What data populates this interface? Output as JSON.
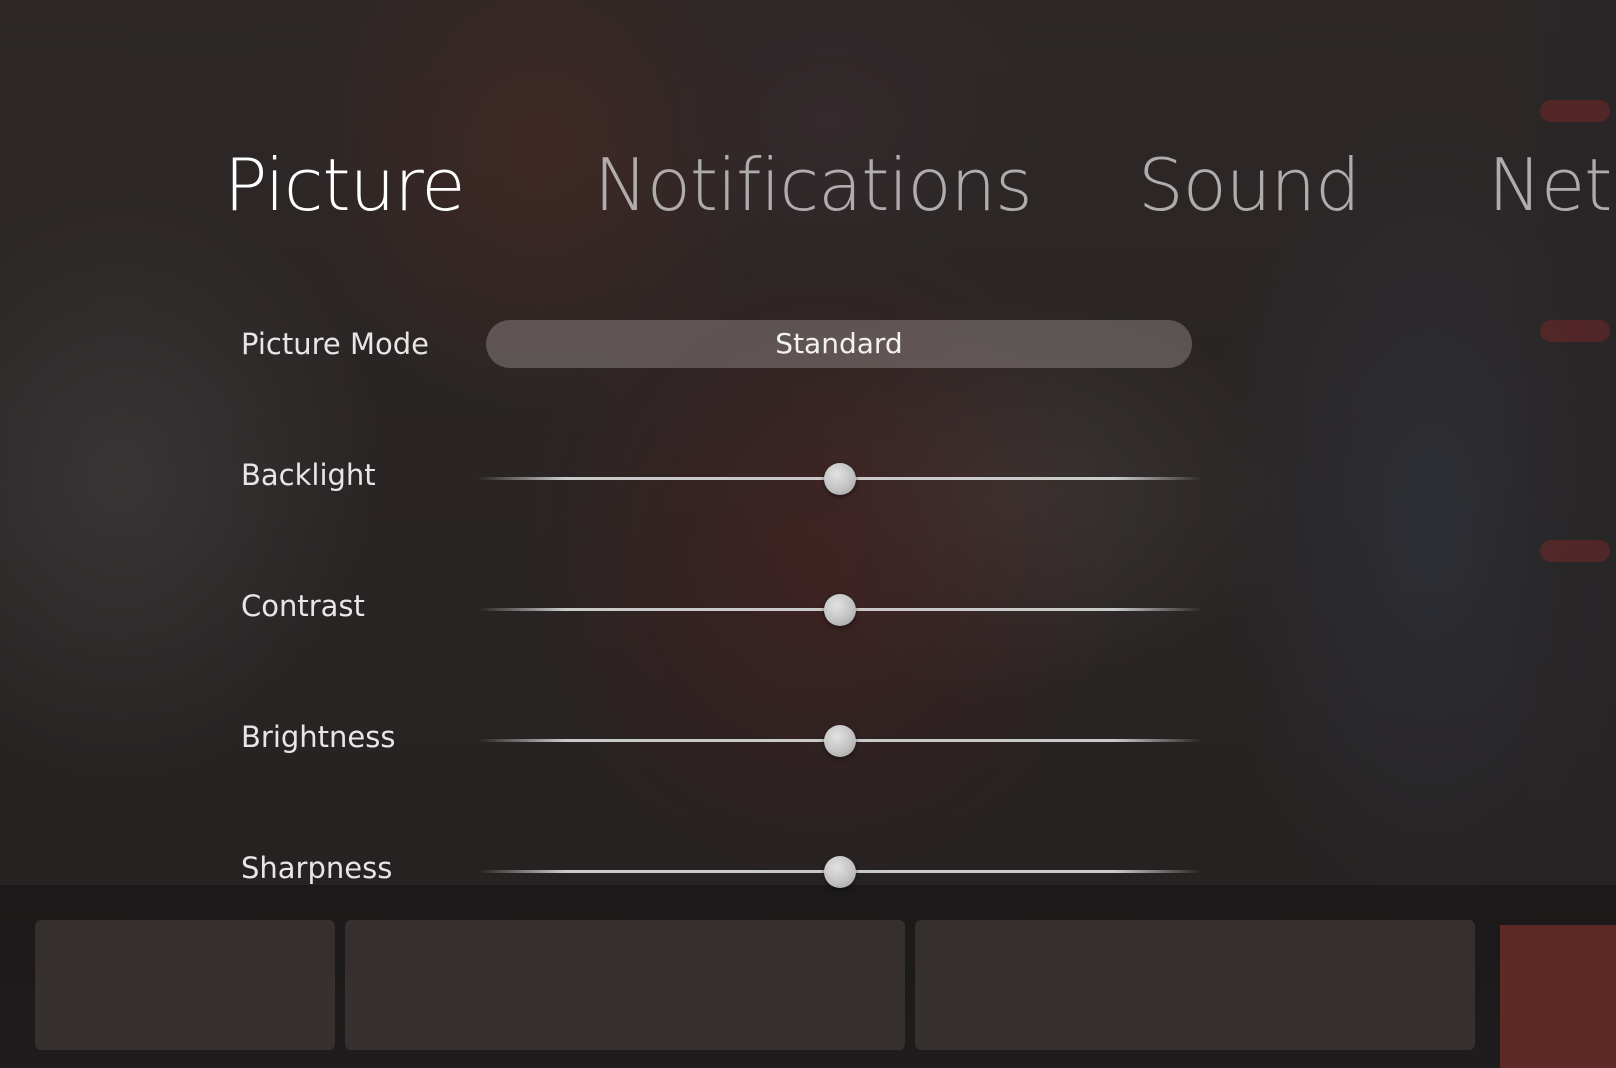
{
  "tabs": [
    {
      "label": "Picture",
      "active": true
    },
    {
      "label": "Notifications",
      "active": false
    },
    {
      "label": "Sound",
      "active": false
    },
    {
      "label": "Netw",
      "active": false
    }
  ],
  "picture_mode": {
    "label": "Picture Mode",
    "value": "Standard"
  },
  "sliders": [
    {
      "label": "Backlight",
      "value_fraction": 0.5
    },
    {
      "label": "Contrast",
      "value_fraction": 0.5
    },
    {
      "label": "Brightness",
      "value_fraction": 0.5
    },
    {
      "label": "Sharpness",
      "value_fraction": 0.5
    }
  ],
  "colors": {
    "active_tab": "#ffffff",
    "inactive_tab": "#d9d9d9",
    "label_text": "#e6e6e6",
    "pill_background": "#8a8282",
    "knob": "#c2c2c2"
  }
}
